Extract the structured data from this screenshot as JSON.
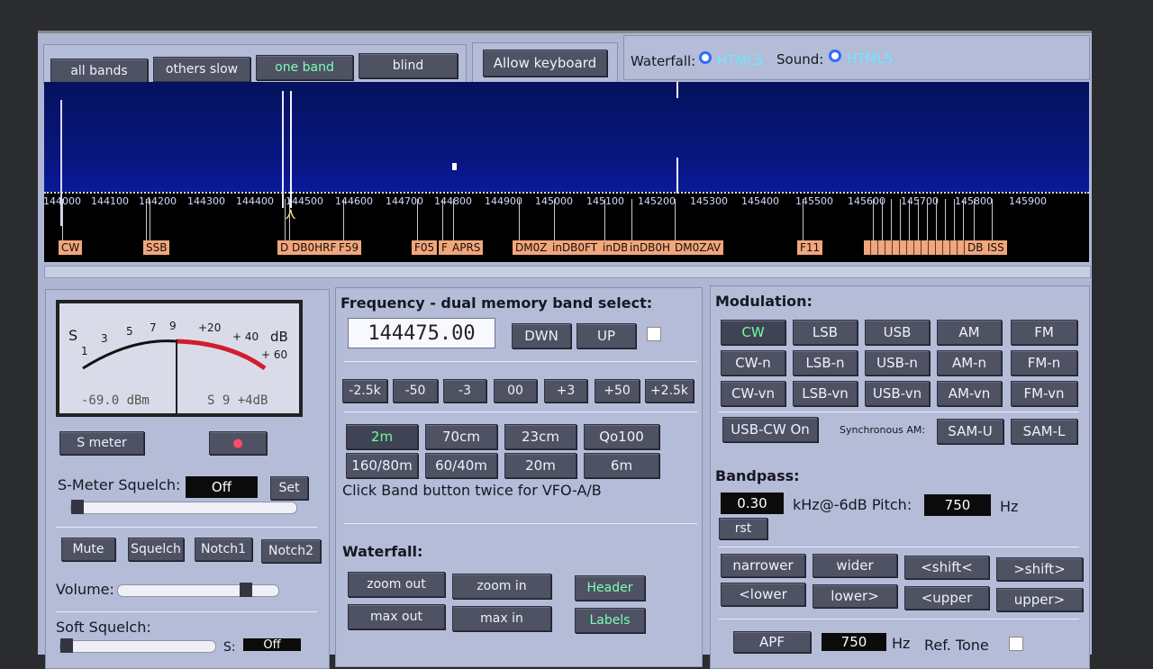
{
  "top_buttons": {
    "all_bands": "all bands",
    "others_slow": "others slow",
    "one_band": "one band",
    "blind": "blind",
    "allow_keyboard": "Allow keyboard"
  },
  "waterfall_opt": {
    "label": "Waterfall:",
    "option": "HTML5"
  },
  "sound_opt": {
    "label": "Sound:",
    "option": "HTML5"
  },
  "scale_ticks": [
    "144000",
    "144100",
    "144200",
    "144300",
    "144400",
    "144500",
    "144600",
    "144700",
    "144800",
    "144900",
    "145000",
    "145100",
    "145200",
    "145300",
    "145400",
    "145500",
    "145600",
    "145700",
    "145800",
    "145900"
  ],
  "band_tags": [
    "CW",
    "SSB",
    "D",
    "DB0HRF",
    "F59",
    "F05",
    "F",
    "APRS",
    "DM0Z",
    "inDB0FT",
    "inDB",
    "inDB0H",
    "DM0ZAV",
    "F11",
    "DB",
    "ISS"
  ],
  "smeter": {
    "s": "S",
    "t1": "1",
    "t3": "3",
    "t5": "5",
    "t7": "7",
    "t9": "9",
    "p20": "+20",
    "p40": "+ 40",
    "p60": "+ 60",
    "db": "dB",
    "dbm": "-69.0 dBm",
    "s_reading": "S 9 +4dB",
    "button": "S meter"
  },
  "squelch": {
    "label": "S-Meter Squelch:",
    "value": "Off",
    "set": "Set"
  },
  "audio_buttons": {
    "mute": "Mute",
    "squelch": "Squelch",
    "notch1": "Notch1",
    "notch2": "Notch2"
  },
  "volume": {
    "label": "Volume:",
    "position": 0.76
  },
  "soft_squelch": {
    "label": "Soft Squelch:",
    "s": "S:",
    "value": "Off"
  },
  "frequency": {
    "title": "Frequency - dual memory band select:",
    "value": "144475.00",
    "dwn": "DWN",
    "up": "UP"
  },
  "steps": [
    "-2.5k",
    "-50",
    "-3",
    "00",
    "+3",
    "+50",
    "+2.5k"
  ],
  "bands": [
    "2m",
    "70cm",
    "23cm",
    "Qo100",
    "160/80m",
    "60/40m",
    "20m",
    "6m"
  ],
  "band_hint": "Click Band button twice for VFO-A/B",
  "waterfall_ctl": {
    "title": "Waterfall:",
    "zoom_out": "zoom out",
    "zoom_in": "zoom in",
    "header": "Header",
    "max_out": "max out",
    "max_in": "max in",
    "labels": "Labels"
  },
  "modulation": {
    "title": "Modulation:",
    "modes": [
      "CW",
      "LSB",
      "USB",
      "AM",
      "FM",
      "CW-n",
      "LSB-n",
      "USB-n",
      "AM-n",
      "FM-n",
      "CW-vn",
      "LSB-vn",
      "USB-vn",
      "AM-vn",
      "FM-vn"
    ],
    "usb_cw": "USB-CW On",
    "sync_label": "Synchronous AM:",
    "sam_u": "SAM-U",
    "sam_l": "SAM-L"
  },
  "bandpass": {
    "title": "Bandpass:",
    "width": "0.30",
    "khz_label": "kHz@-6dB Pitch:",
    "pitch": "750",
    "hz": "Hz",
    "rst": "rst",
    "buttons": [
      "narrower",
      "wider",
      "<shift<",
      ">shift>",
      "<lower",
      "lower>",
      "<upper",
      "upper>"
    ]
  },
  "apf": {
    "label": "APF",
    "value": "750",
    "hz": "Hz",
    "ref_tone": "Ref. Tone"
  }
}
